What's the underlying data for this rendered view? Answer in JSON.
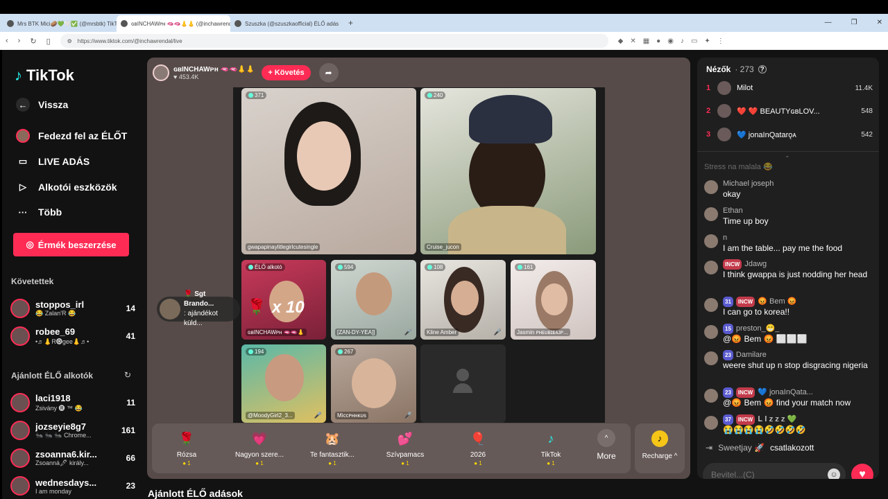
{
  "browser": {
    "tabs": [
      {
        "title": "Mrs BTK Mici🥔💚🤍✅ (@mrsbtk) TikTok"
      },
      {
        "title": "ɢʙINCHAWᴘʜ 🫦🫦👃👃 (@inchawrendal)"
      },
      {
        "title": "Szuszka (@szuszkaofficial) ÉLŐ adás"
      }
    ],
    "url": "https://www.tiktok.com/@inchawrendal/live"
  },
  "sidebar": {
    "logo": "TikTok",
    "back": "Vissza",
    "nav": [
      {
        "label": "Fedezd fel az ÉLŐT"
      },
      {
        "label": "LIVE ADÁS"
      },
      {
        "label": "Alkotói eszközök"
      },
      {
        "label": "Több"
      }
    ],
    "coins_button": "Érmék beszerzése",
    "following_title": "Követettek",
    "following": [
      {
        "name": "stoppos_irl",
        "sub": "😂 Zalan'R 😂",
        "count": "14"
      },
      {
        "name": "robee_69",
        "sub": "•♬👃R🅞ɡee👃♬•",
        "count": "41"
      }
    ],
    "recommended_title": "Ajánlott ÉLŐ alkotók",
    "recommended": [
      {
        "name": "laci1918",
        "sub": "Zsivány 🅡 ™ 😂",
        "count": "11"
      },
      {
        "name": "jozseyie8g7",
        "sub": "🐜 🐜 🐜 Chrome...",
        "count": "161"
      },
      {
        "name": "zsoanna6.kir...",
        "sub": "Zsoanná🖋 király...",
        "count": "66"
      },
      {
        "name": "wednesdays...",
        "sub": "I am monday",
        "count": "23"
      }
    ]
  },
  "stage": {
    "host_name": "ɢʙINCHAWᴘʜ 🫦🫦👃👃",
    "host_likes": "♥ 453.4K",
    "follow_label": "+ Követés",
    "tiles": [
      {
        "name": "gwapapinaylitlegirlcutesingle",
        "count": "371"
      },
      {
        "name": "Cruise_jucon",
        "count": "240"
      },
      {
        "name": "ɢʙINCHAWᴘʜ 🫦🫦👃",
        "count": "ÉLŐ alkotó"
      },
      {
        "name": "[ZAN-DY-YEA]]",
        "count": "594"
      },
      {
        "name": "Kline Amber",
        "count": "108"
      },
      {
        "name": "Jasmin ᴘʜᴇᴜʙɪᴇᴀᴊᴘ...",
        "count": "161"
      },
      {
        "name": "@MoodyGirl2_3...",
        "count": "194"
      },
      {
        "name": "Miccᴘʜʜᴋᴜs",
        "count": "267"
      }
    ],
    "gift_combo": "x 10",
    "gift_note": {
      "name": "🌹 Sgt Brando...",
      "text": ": ajándékot küld..."
    }
  },
  "gifts": [
    {
      "name": "Rózsa",
      "price": "1",
      "icon": "🌹"
    },
    {
      "name": "Nagyon szere...",
      "price": "1",
      "icon": "💗"
    },
    {
      "name": "Te fantasztik...",
      "price": "1",
      "icon": "🐹"
    },
    {
      "name": "Szívpamacs",
      "price": "1",
      "icon": "💕"
    },
    {
      "name": "2026",
      "price": "1",
      "icon": "🎈"
    },
    {
      "name": "TikTok",
      "price": "1",
      "icon": "♪"
    }
  ],
  "more_label": "More",
  "recharge_label": "Recharge ^",
  "recommended_live_title": "Ajánlott ÉLŐ adások",
  "chat": {
    "viewers_label": "Nézők",
    "viewers_count": "· 273",
    "ranking": [
      {
        "rank": "1",
        "name": "Milot",
        "score": "11.4K"
      },
      {
        "rank": "2",
        "name": "❤️ ❤️ BEAUTYɢʙLOV...",
        "score": "548"
      },
      {
        "rank": "3",
        "name": "💙 jonaInQatarǫᴀ",
        "score": "542"
      }
    ],
    "messages": [
      {
        "name": "Stress na malala 😂",
        "badges": [],
        "text": ""
      },
      {
        "name": "Michael joseph",
        "badges": [],
        "text": "okay"
      },
      {
        "name": "Ethan",
        "badges": [],
        "text": "Time up boy"
      },
      {
        "name": "n",
        "badges": [],
        "text": "I am the table... pay me the food"
      },
      {
        "name": "Jdawg",
        "badges": [
          "INCW"
        ],
        "text": "I think gwappa is just nodding her head"
      },
      {
        "name": "😡 Bem 😡",
        "badges": [
          "31",
          "INCW"
        ],
        "text": "I can go to korea!!"
      },
      {
        "name": "preston_😁_",
        "badges": [
          "15"
        ],
        "text": "@😡 Bem 😡 ⬜⬜⬜"
      },
      {
        "name": "Damilare",
        "badges": [
          "23"
        ],
        "text": "weere shut up n stop disgracing nigeria"
      },
      {
        "name": "💙 jonaInQata...",
        "badges": [
          "23",
          "INCW"
        ],
        "text": "@😡 Bem 😡 find your match now"
      },
      {
        "name": "𝐋 𝐈 𝐳 𝐳 𝐳 💚",
        "badges": [
          "37",
          "INCW"
        ],
        "text": "😭😭😭😭🤣🤣🤣🤣"
      }
    ],
    "joined_name": "Sweetjay 🚀",
    "joined_text": "csatlakozott",
    "input_placeholder": "Bevitel...(C)"
  },
  "colors": {
    "accent": "#fe2c55",
    "stage_bg": "#564b49",
    "panel_bg": "#1f1f1f"
  }
}
